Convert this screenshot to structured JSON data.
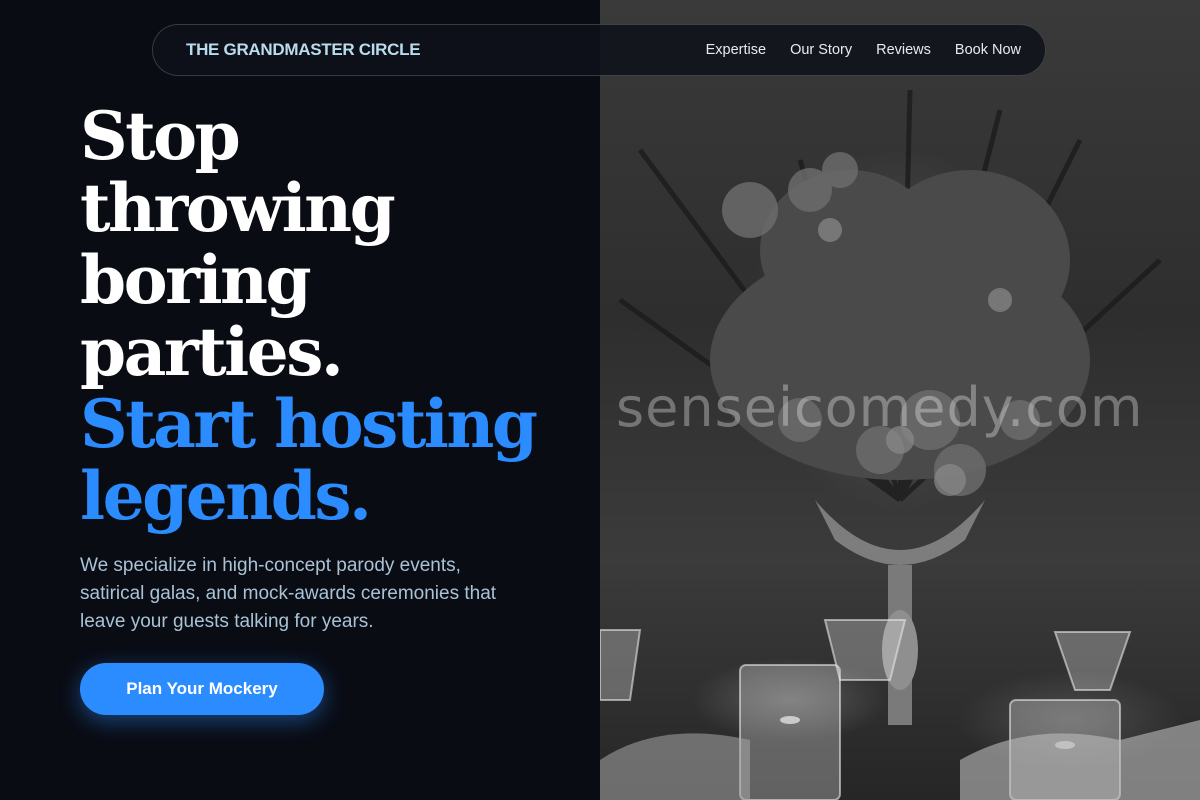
{
  "nav": {
    "brand": "THE GRANDMASTER CIRCLE",
    "links": [
      "Expertise",
      "Our Story",
      "Reviews",
      "Book Now"
    ]
  },
  "hero": {
    "headline_lines": [
      "Stop",
      "throwing",
      "boring",
      "parties."
    ],
    "accent_lines": [
      "Start hosting",
      "legends."
    ],
    "description": "We specialize in high-concept parody events, satirical galas, and mock-awards ceremonies that leave your guests talking for years.",
    "cta_label": "Plan Your Mockery"
  },
  "image": {
    "subject": "floral centerpiece with glassware",
    "watermark": "senseicomedy.com"
  },
  "colors": {
    "background": "#0a0c14",
    "accent": "#2b8cff",
    "brand_text": "#b9dcec",
    "body_text": "#a9c2d6"
  }
}
